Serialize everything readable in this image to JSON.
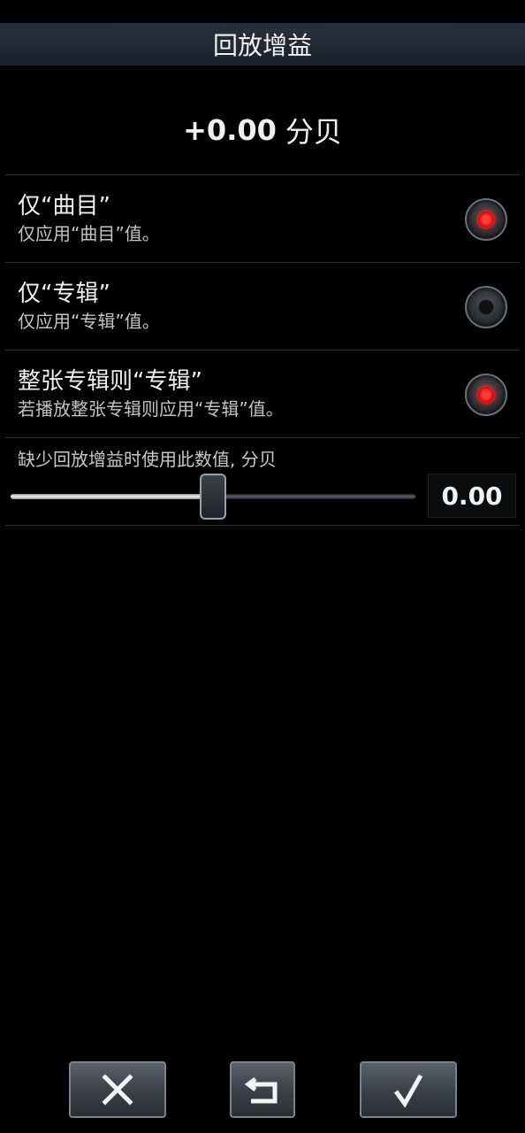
{
  "header": {
    "title": "回放增益"
  },
  "gain": {
    "value": "+0.00",
    "unit": "分贝"
  },
  "options": [
    {
      "title": "仅“曲目”",
      "subtitle": "仅应用“曲目”值。",
      "checked": true
    },
    {
      "title": "仅“专辑”",
      "subtitle": "仅应用“专辑”值。",
      "checked": false
    },
    {
      "title": "整张专辑则“专辑”",
      "subtitle": "若播放整张专辑则应用“专辑”值。",
      "checked": true
    }
  ],
  "fallback": {
    "label": "缺少回放增益时使用此数值, 分贝",
    "value_text": "0.00",
    "slider_fraction": 0.5
  },
  "footer": {
    "cancel_icon": "close-icon",
    "reset_icon": "undo-icon",
    "confirm_icon": "check-icon"
  },
  "colors": {
    "accent_red": "#ff2020",
    "title_bar": "#1f2833"
  }
}
